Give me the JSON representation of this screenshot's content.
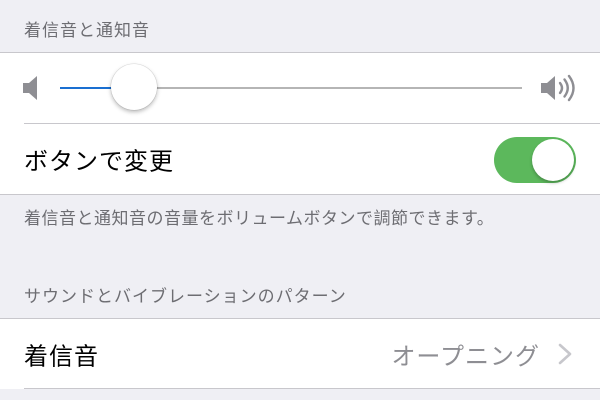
{
  "sections": {
    "ringtone_alert_header": "着信音と通知音",
    "change_with_buttons_label": "ボタンで変更",
    "change_with_buttons_enabled": true,
    "volume_level": 0.16,
    "volume_footer": "着信音と通知音の音量をボリュームボタンで調節できます。",
    "sounds_vibration_header": "サウンドとバイブレーションのパターン",
    "ringtone_label": "着信音",
    "ringtone_value": "オープニング"
  },
  "colors": {
    "toggle_on": "#5cb85c",
    "slider_fill": "#1a6fd1",
    "background": "#efeff4"
  },
  "icons": {
    "volume_low": "speaker-low-icon",
    "volume_high": "speaker-high-icon",
    "disclosure": "chevron-right-icon"
  }
}
